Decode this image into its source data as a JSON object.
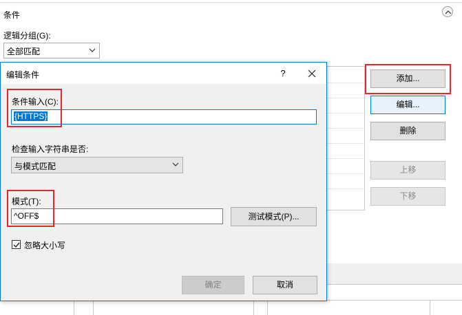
{
  "background": {
    "section_title": "条件",
    "grouping_label": "逻辑分组(G):",
    "grouping_value": "全部匹配",
    "buttons": {
      "add": "添加...",
      "edit": "编辑...",
      "remove": "删除",
      "move_up": "上移",
      "move_down": "下移"
    }
  },
  "dialog": {
    "title": "编辑条件",
    "help": "?",
    "condition_input_label": "条件输入(C):",
    "condition_input_value": "{HTTPS}",
    "check_label": "检查输入字符串是否:",
    "check_value": "与模式匹配",
    "pattern_label": "模式(T):",
    "pattern_value": "^OFF$",
    "test_button": "测试模式(P)...",
    "ignore_case_label": "忽略大小写",
    "ignore_case_checked": true,
    "ok_button": "确定",
    "cancel_button": "取消"
  },
  "colors": {
    "highlight_red": "#e8262a",
    "accent_blue": "#0078d7",
    "dialog_bg": "#f0f0f0"
  }
}
